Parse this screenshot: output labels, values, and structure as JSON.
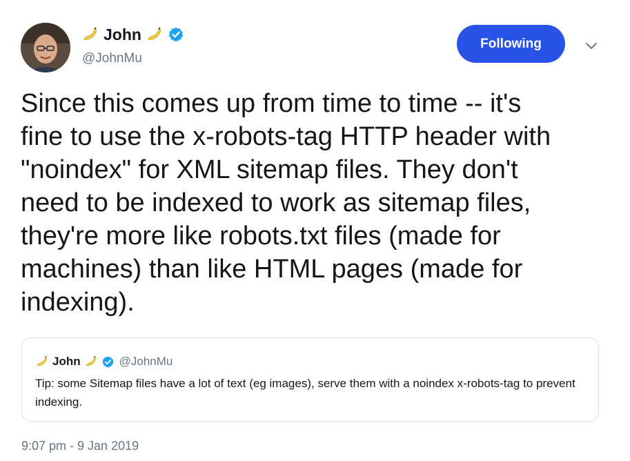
{
  "author": {
    "display_name": "John",
    "handle": "@JohnMu",
    "emoji_icon": "banana-icon",
    "verified_color": "#1da1f2"
  },
  "follow_button": {
    "label": "Following",
    "color": "#2853e6"
  },
  "menu_icon": "chevron-down-icon",
  "tweet": {
    "text": "Since this comes up from time to time -- it's\nfine to use the x-robots-tag HTTP header with\n\"noindex\" for XML sitemap files. They don't\nneed to be indexed to work as sitemap files,\nthey're more like robots.txt files (made for\nmachines) than like HTML pages (made for\nindexing).",
    "timestamp": "9:07 pm - 9 Jan 2019"
  },
  "quoted_tweet": {
    "display_name": "John",
    "handle": "@JohnMu",
    "text": "Tip: some Sitemap files have a lot of text (eg images), serve them with a noindex x-robots-tag to prevent indexing."
  }
}
